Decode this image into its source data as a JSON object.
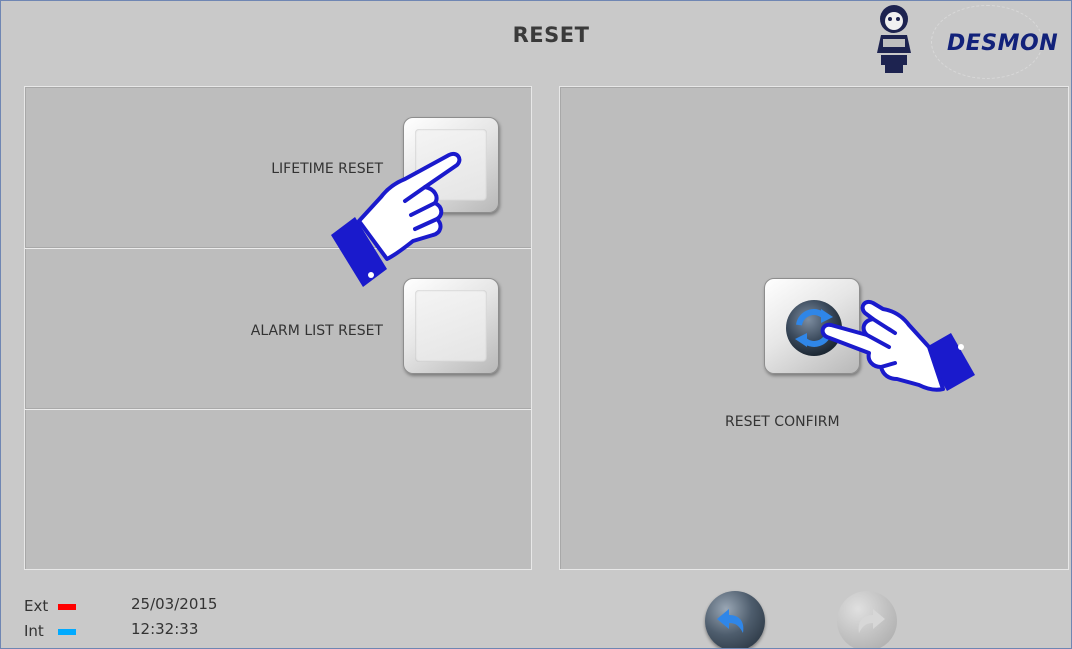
{
  "header": {
    "title": "RESET",
    "logo_text": "DESMON"
  },
  "left_panel": {
    "rows": [
      {
        "label": "LIFETIME RESET"
      },
      {
        "label": "ALARM LIST RESET"
      },
      {
        "label": ""
      }
    ]
  },
  "right_panel": {
    "confirm_label": "RESET CONFIRM"
  },
  "footer": {
    "ext_label": "Ext",
    "int_label": "Int",
    "ext_color": "#ff0000",
    "int_color": "#00aaff",
    "date": "25/03/2015",
    "time": "12:32:33"
  },
  "icons": {
    "reset_confirm": "refresh-icon",
    "back": "back-arrow-icon",
    "forward": "forward-arrow-icon",
    "hint": "pointing-hand-icon"
  },
  "colors": {
    "hand": "#1a1acc",
    "logo": "#12227a",
    "refresh": "#1f6fd6"
  }
}
